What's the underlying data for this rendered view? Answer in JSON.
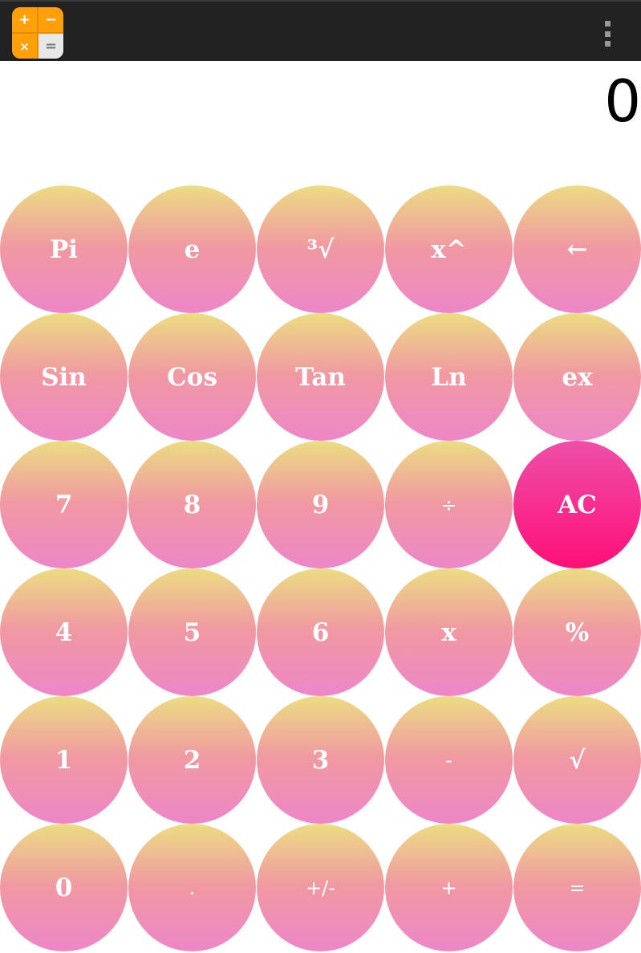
{
  "topbar": {
    "app_icon": "calculator-app-icon",
    "icon_symbols": [
      "+",
      "−",
      "×",
      "="
    ],
    "menu_icon": "overflow-menu-icon"
  },
  "display": {
    "value": "0"
  },
  "keys": [
    {
      "label": "Pi",
      "name": "pi-key"
    },
    {
      "label": "e",
      "name": "euler-key"
    },
    {
      "label": "³√",
      "name": "cube-root-key"
    },
    {
      "label": "x^",
      "name": "power-key"
    },
    {
      "label": "←",
      "name": "backspace-key"
    },
    {
      "label": "Sin",
      "name": "sin-key"
    },
    {
      "label": "Cos",
      "name": "cos-key"
    },
    {
      "label": "Tan",
      "name": "tan-key"
    },
    {
      "label": "Ln",
      "name": "ln-key"
    },
    {
      "label": "ex",
      "name": "exp-key"
    },
    {
      "label": "7",
      "name": "digit-7-key"
    },
    {
      "label": "8",
      "name": "digit-8-key"
    },
    {
      "label": "9",
      "name": "digit-9-key"
    },
    {
      "label": "÷",
      "name": "divide-key"
    },
    {
      "label": "AC",
      "name": "all-clear-key"
    },
    {
      "label": "4",
      "name": "digit-4-key"
    },
    {
      "label": "5",
      "name": "digit-5-key"
    },
    {
      "label": "6",
      "name": "digit-6-key"
    },
    {
      "label": "x",
      "name": "multiply-key"
    },
    {
      "label": "%",
      "name": "percent-key"
    },
    {
      "label": "1",
      "name": "digit-1-key"
    },
    {
      "label": "2",
      "name": "digit-2-key"
    },
    {
      "label": "3",
      "name": "digit-3-key"
    },
    {
      "label": "-",
      "name": "subtract-key"
    },
    {
      "label": "√",
      "name": "square-root-key"
    },
    {
      "label": "0",
      "name": "digit-0-key"
    },
    {
      "label": ".",
      "name": "decimal-key"
    },
    {
      "label": "+/-",
      "name": "negate-key"
    },
    {
      "label": "+",
      "name": "add-key"
    },
    {
      "label": "=",
      "name": "equals-key"
    }
  ],
  "colors": {
    "key_gradient_top": "#ecdd82",
    "key_gradient_mid": "#f099a2",
    "key_gradient_bottom": "#ee86c8",
    "ac_gradient_top": "#ee4fa8",
    "ac_gradient_bottom": "#ff0f78",
    "topbar": "#222222"
  }
}
